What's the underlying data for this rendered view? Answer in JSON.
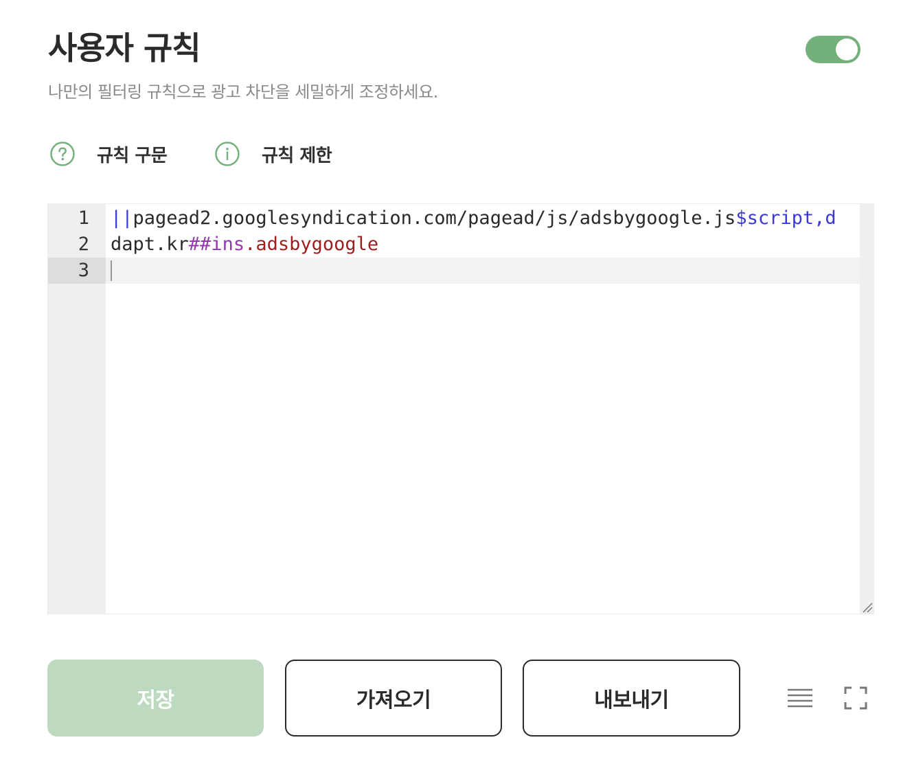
{
  "header": {
    "title": "사용자 규칙",
    "subtitle": "나만의 필터링 규칙으로 광고 차단을 세밀하게 조정하세요.",
    "enabled": true
  },
  "help": {
    "syntax_label": "규칙 구문",
    "syntax_icon": "question-circle-icon",
    "limits_label": "규칙 제한",
    "limits_icon": "info-circle-icon"
  },
  "editor": {
    "active_line": 3,
    "lines": [
      {
        "number": "1",
        "tokens": [
          {
            "text": "||",
            "kind": "sep"
          },
          {
            "text": "pagead2.googlesyndication.com/pagead/js/adsbygoogle.js",
            "kind": "plain"
          },
          {
            "text": "$script,d",
            "kind": "opt"
          }
        ]
      },
      {
        "number": "2",
        "tokens": [
          {
            "text": "dapt.kr",
            "kind": "plain"
          },
          {
            "text": "##ins",
            "kind": "hash"
          },
          {
            "text": ".adsbygoogle",
            "kind": "sel"
          }
        ]
      },
      {
        "number": "3",
        "tokens": []
      }
    ]
  },
  "actions": {
    "save_label": "저장",
    "import_label": "가져오기",
    "export_label": "내보내기"
  },
  "tools": {
    "wrap_icon": "line-wrap-icon",
    "fullscreen_icon": "fullscreen-icon"
  },
  "colors": {
    "accent": "#74b07b",
    "save_disabled": "#bdd9bf",
    "token_separator": "#3a3ad0",
    "token_hash": "#9636b0",
    "token_selector": "#9b1f1f"
  }
}
